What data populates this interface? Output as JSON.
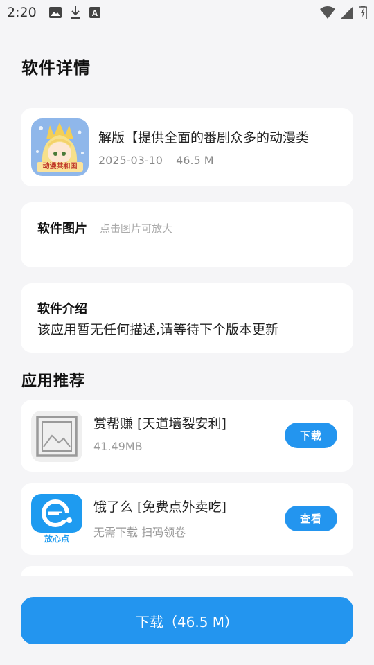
{
  "status_bar": {
    "time": "2:20",
    "left_icons": [
      "image-icon",
      "download-icon",
      "text-box-icon"
    ],
    "right_icons": [
      "wifi-icon",
      "signal-icon",
      "battery-icon"
    ]
  },
  "page_title": "软件详情",
  "app": {
    "name": "解版【提供全面的番剧众多的动漫类",
    "date": "2025-03-10",
    "size": "46.5 M",
    "icon_caption": "动漫共和国"
  },
  "screenshots": {
    "title": "软件图片",
    "hint": "点击图片可放大"
  },
  "intro": {
    "title": "软件介绍",
    "description": "该应用暂无任何描述,请等待下个版本更新"
  },
  "recommend": {
    "title": "应用推荐",
    "items": [
      {
        "name": "赏帮赚 [天道墙裂安利]",
        "sub": "41.49MB",
        "button": "下载",
        "icon": "image-placeholder-icon"
      },
      {
        "name": "饿了么 [免费点外卖吃]",
        "sub": "无需下载 扫码领卷",
        "button": "查看",
        "icon": "eleme-logo-icon",
        "icon_caption": "放心点"
      }
    ]
  },
  "download_button": "下载（46.5 M）",
  "colors": {
    "accent": "#2395ef",
    "background": "#f5f5f7",
    "card": "#ffffff"
  }
}
